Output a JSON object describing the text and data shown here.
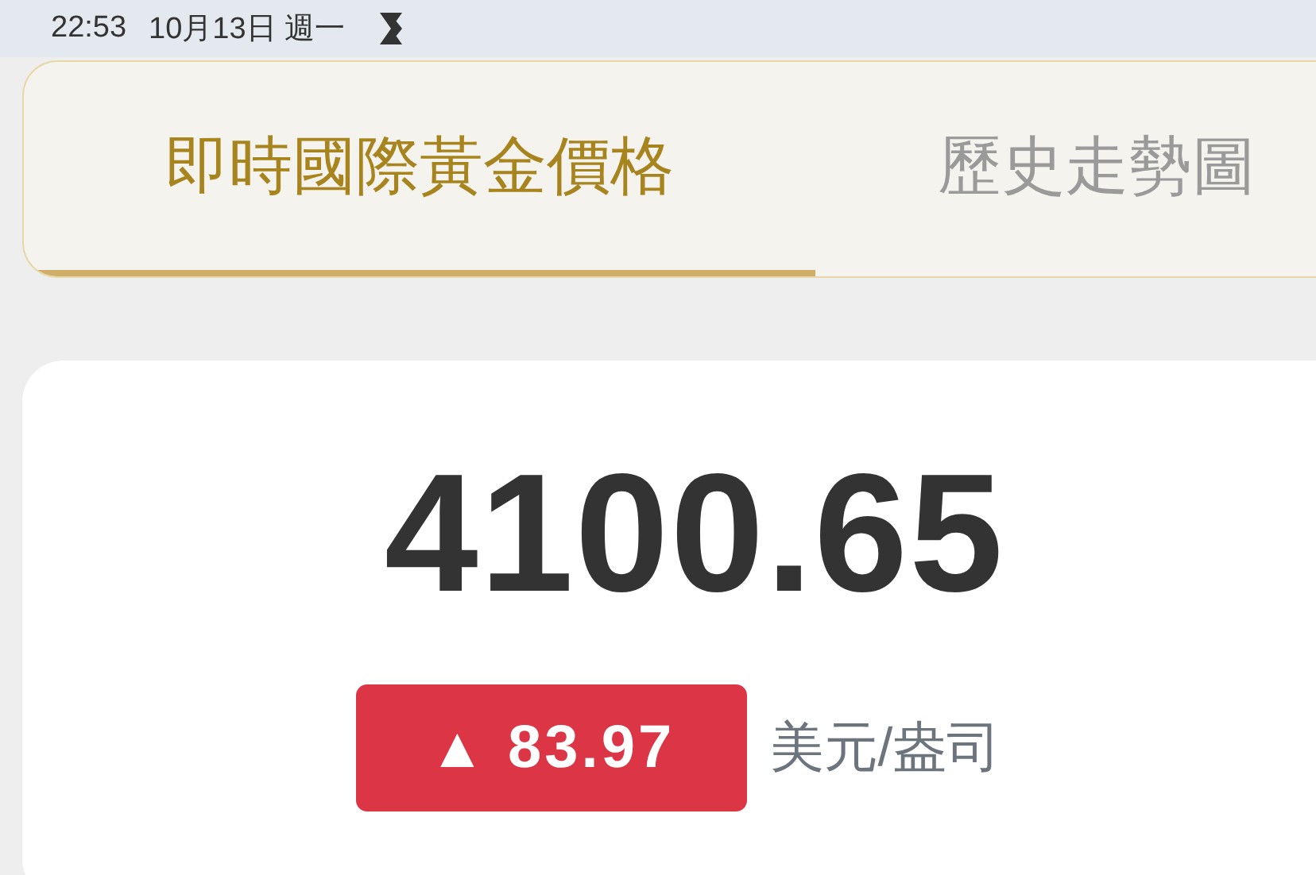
{
  "status_bar": {
    "time": "22:53",
    "date": "10月13日 週一"
  },
  "tabs": [
    {
      "label": "即時國際黃金價格",
      "selected": true
    },
    {
      "label": "歷史走勢圖",
      "selected": false
    }
  ],
  "price_card": {
    "price": "4100.65",
    "change": {
      "arrow": "▲",
      "value": "83.97"
    },
    "unit": "美元/盎司"
  }
}
